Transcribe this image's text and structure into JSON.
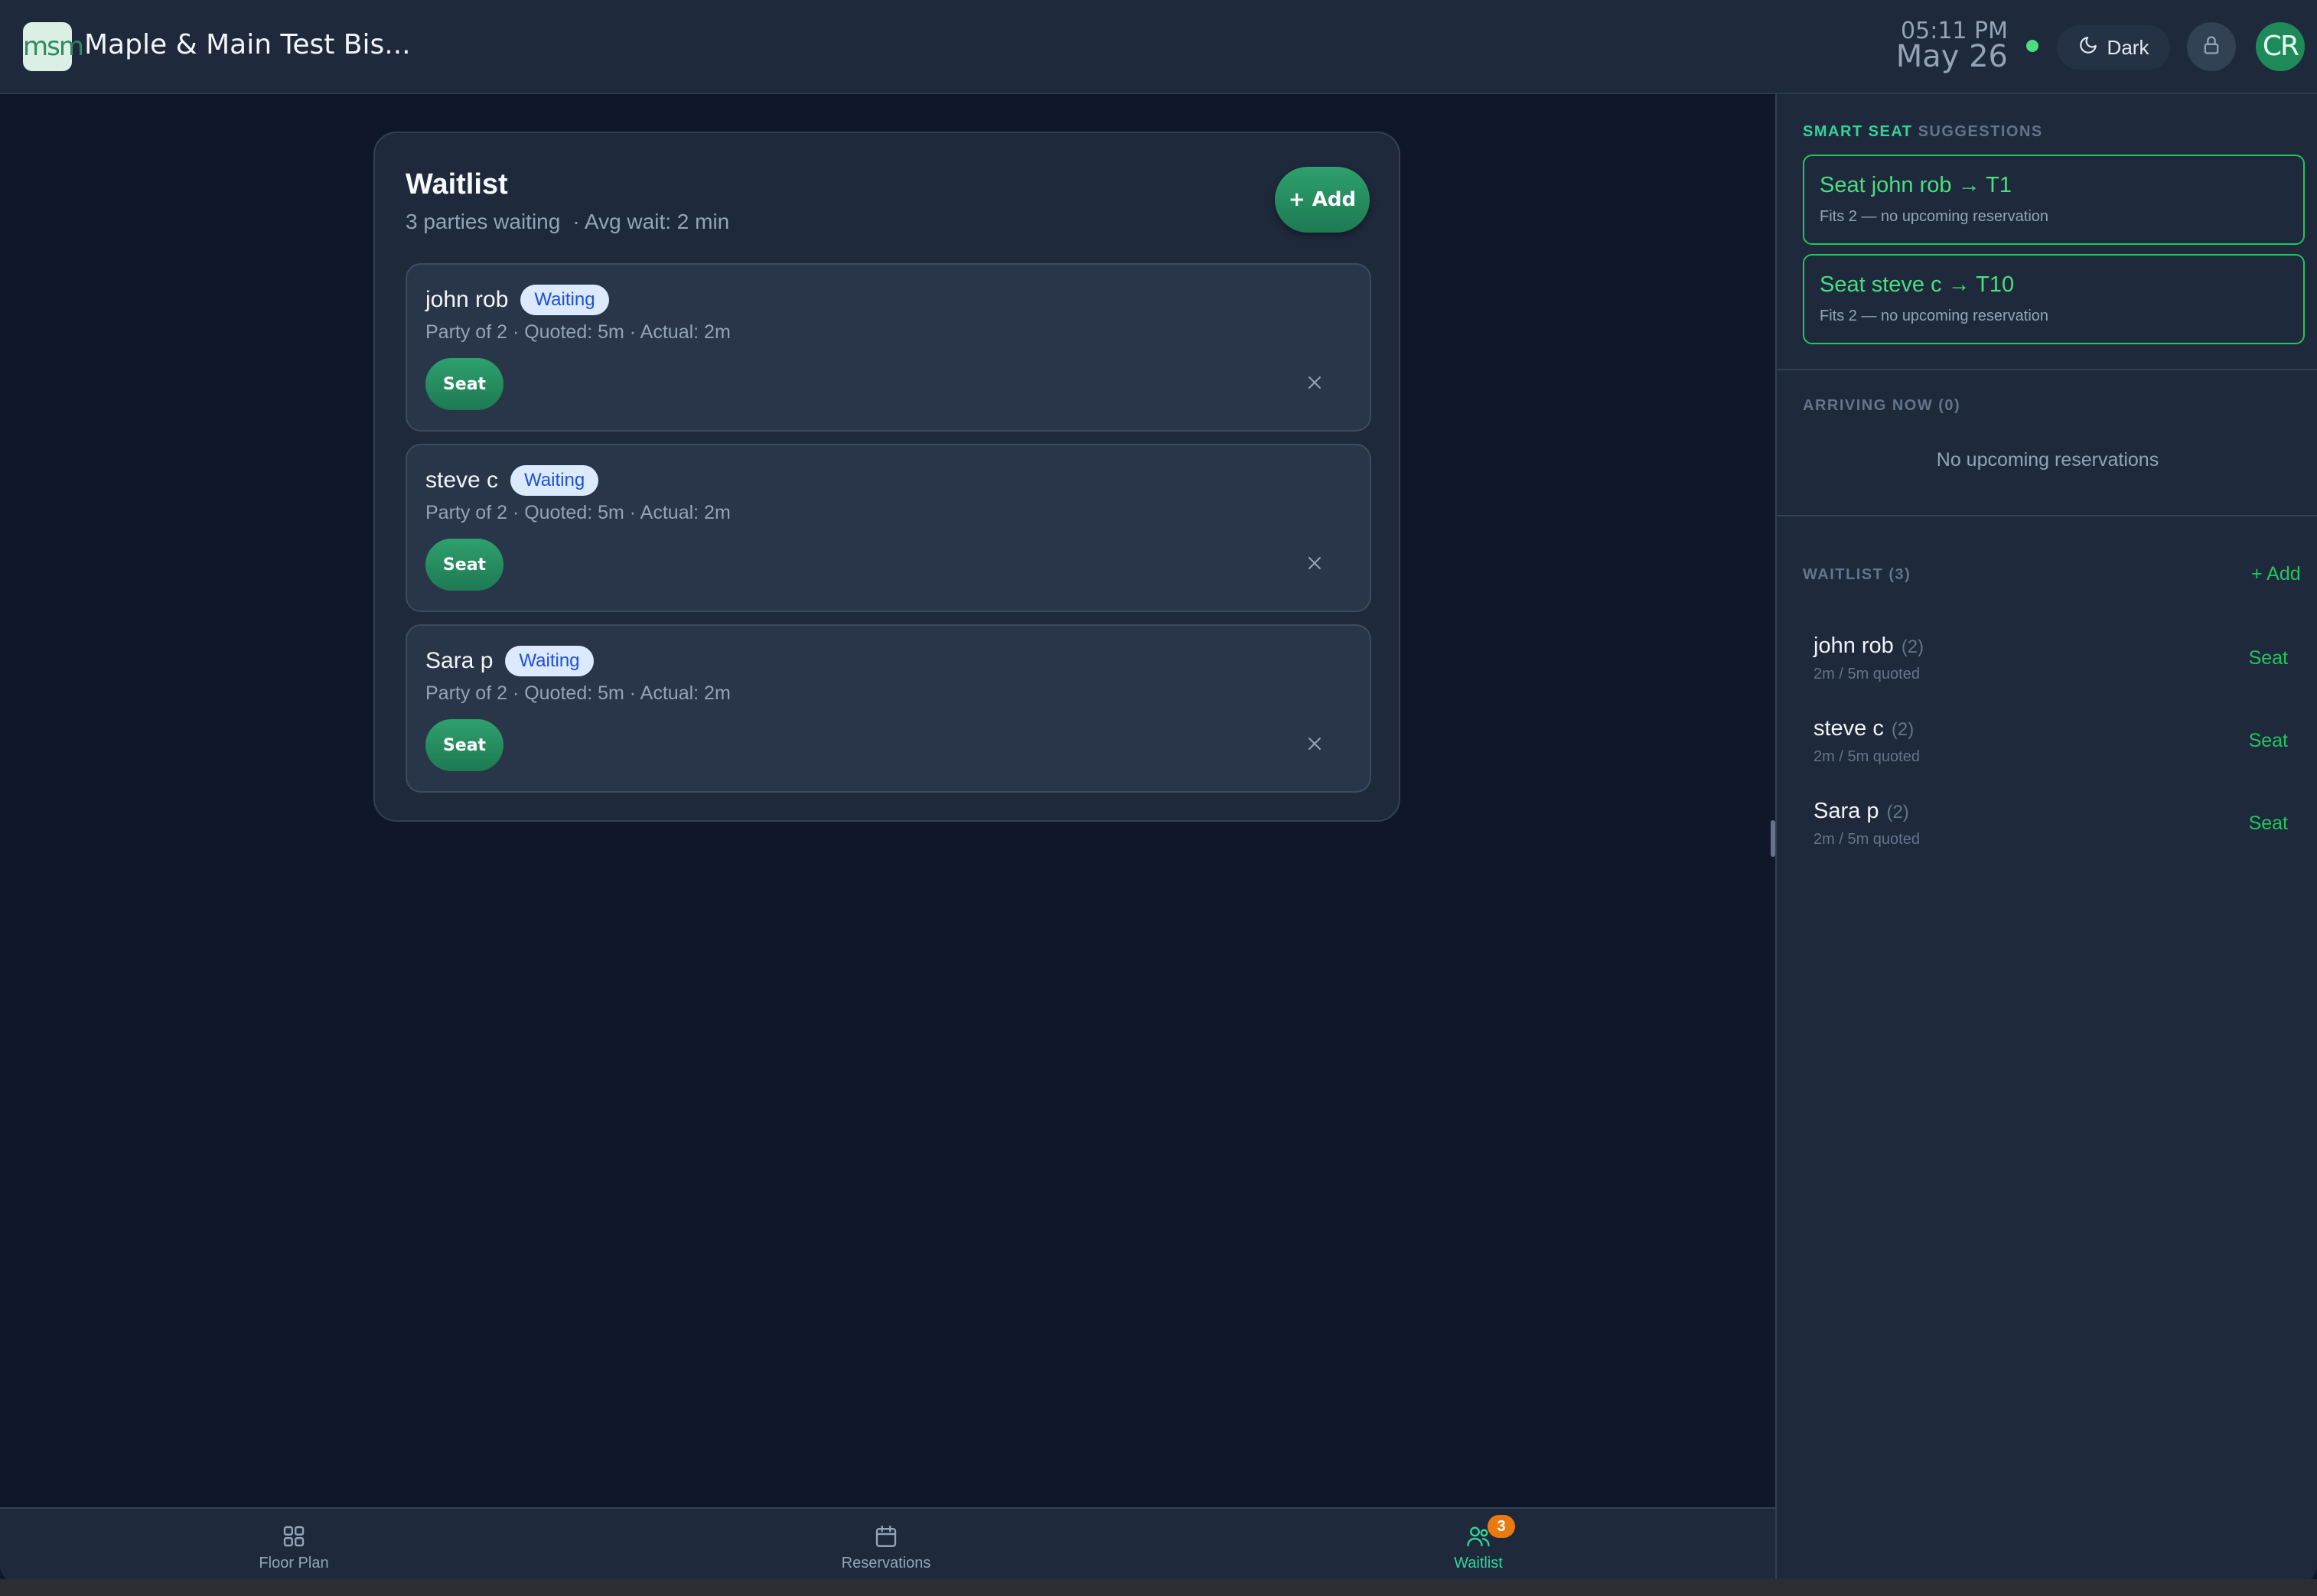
{
  "header": {
    "logo_text": "msm",
    "business_name": "Maple & Main Test Bis...",
    "time": "05:11 PM",
    "date": "May 26",
    "theme_label": "Dark",
    "avatar_initials": "CR",
    "status_color": "#4ade80"
  },
  "waitlist": {
    "title": "Waitlist",
    "parties_waiting": "3 parties waiting",
    "avg_wait": "· Avg wait: 2 min",
    "add_label": "+ Add",
    "entries": [
      {
        "name": "john rob",
        "status": "Waiting",
        "meta": "Party of 2 · Quoted: 5m · Actual: 2m",
        "seat_label": "Seat"
      },
      {
        "name": "steve c",
        "status": "Waiting",
        "meta": "Party of 2 · Quoted: 5m · Actual: 2m",
        "seat_label": "Seat"
      },
      {
        "name": "Sara p",
        "status": "Waiting",
        "meta": "Party of 2 · Quoted: 5m · Actual: 2m",
        "seat_label": "Seat"
      }
    ]
  },
  "sidebar": {
    "suggestions_heading_accent": "SMART SEAT",
    "suggestions_heading_rest": " SUGGESTIONS",
    "suggestions": [
      {
        "title": "Seat john rob → T1",
        "subtitle": "Fits 2 — no upcoming reservation"
      },
      {
        "title": "Seat steve c → T10",
        "subtitle": "Fits 2 — no upcoming reservation"
      }
    ],
    "arriving_heading": "ARRIVING NOW (0)",
    "arriving_empty": "No upcoming reservations",
    "waitlist_heading": "WAITLIST (3)",
    "waitlist_add": "+ Add",
    "waitlist_rows": [
      {
        "name": "john rob",
        "count": "(2)",
        "sub": "2m / 5m quoted",
        "seat_label": "Seat"
      },
      {
        "name": "steve c",
        "count": "(2)",
        "sub": "2m / 5m quoted",
        "seat_label": "Seat"
      },
      {
        "name": "Sara p",
        "count": "(2)",
        "sub": "2m / 5m quoted",
        "seat_label": "Seat"
      }
    ]
  },
  "bottom_nav": {
    "items": [
      {
        "label": "Floor Plan",
        "icon": "grid-icon"
      },
      {
        "label": "Reservations",
        "icon": "calendar-icon"
      },
      {
        "label": "Waitlist",
        "icon": "users-icon",
        "badge": "3",
        "active": true
      }
    ]
  },
  "colors": {
    "background": "#0f172a",
    "surface": "#1e293b",
    "accent_green": "#22c55e",
    "badge_orange": "#ea7a10"
  }
}
